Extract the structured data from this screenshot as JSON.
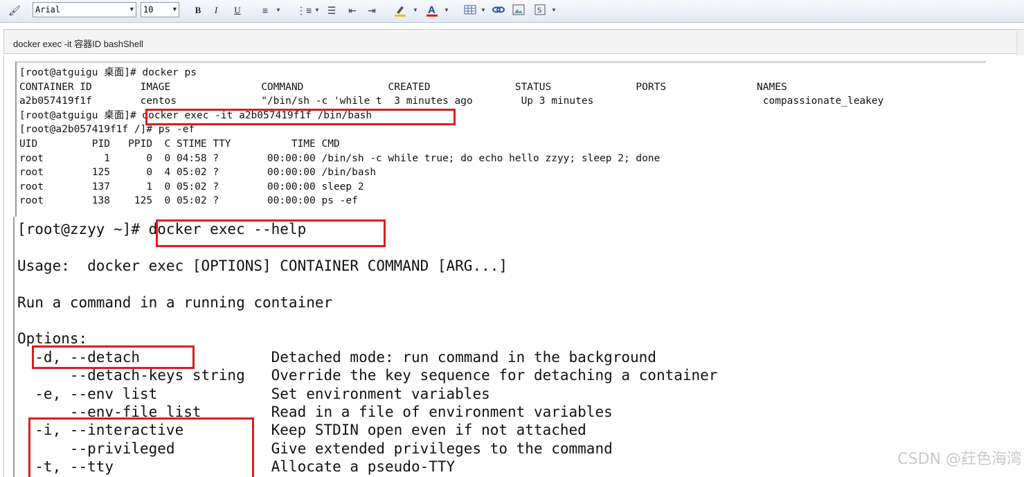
{
  "toolbar": {
    "font_name": "Arial",
    "font_size": "10",
    "bold": "B",
    "italic": "I",
    "underline": "U",
    "icons": [
      "brush-icon",
      "align-icon",
      "numbered-list-icon",
      "bulleted-list-icon",
      "outdent-icon",
      "indent-icon",
      "highlight-icon",
      "font-color-icon",
      "table-icon",
      "link-icon",
      "image-icon",
      "special-icon"
    ],
    "highlight_color": "#e8c21a",
    "font_color": "#d81e1e"
  },
  "title": "docker exec -it 容器ID bashShell",
  "terminal_top": {
    "lines": [
      "[root@atguigu 桌面]# docker ps",
      "CONTAINER ID        IMAGE               COMMAND              CREATED              STATUS              PORTS               NAMES",
      "a2b057419f1f        centos              \"/bin/sh -c 'while t  3 minutes ago        Up 3 minutes                            compassionate_leakey",
      "[root@atguigu 桌面]# docker exec -it a2b057419f1f /bin/bash",
      "[root@a2b057419f1f /]# ps -ef",
      "UID         PID   PPID  C STIME TTY          TIME CMD",
      "root          1      0  0 04:58 ?        00:00:00 /bin/sh -c while true; do echo hello zzyy; sleep 2; done",
      "root        125      0  4 05:02 ?        00:00:00 /bin/bash",
      "root        137      1  0 05:02 ?        00:00:00 sleep 2",
      "root        138    125  0 05:02 ?        00:00:00 ps -ef"
    ]
  },
  "terminal_bottom": {
    "lines": [
      "[root@zzyy ~]# docker exec --help",
      "",
      "Usage:  docker exec [OPTIONS] CONTAINER COMMAND [ARG...]",
      "",
      "Run a command in a running container",
      "",
      "Options:",
      "  -d, --detach               Detached mode: run command in the background",
      "      --detach-keys string   Override the key sequence for detaching a container",
      "  -e, --env list             Set environment variables",
      "      --env-file list        Read in a file of environment variables",
      "  -i, --interactive          Keep STDIN open even if not attached",
      "      --privileged           Give extended privileges to the command",
      "  -t, --tty                  Allocate a pseudo-TTY"
    ]
  },
  "highlight_color": "#e11b1b",
  "watermark": "CSDN @荭色海湾"
}
